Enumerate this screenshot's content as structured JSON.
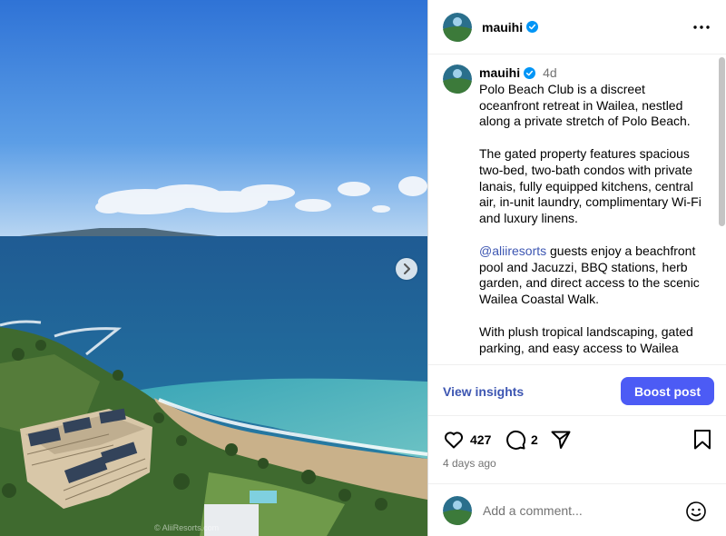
{
  "post": {
    "username": "mauihi",
    "timestamp": "4d",
    "caption": {
      "p1": "Polo Beach Club is a discreet oceanfront retreat in Wailea, nestled along a private stretch of Polo Beach.",
      "p2": "The gated property features spacious two-bed, two-bath condos with private lanais, fully equipped kitchens, central air, in-unit laundry, complimentary Wi-Fi and luxury linens.",
      "p3_mention": "@aliiresorts",
      "p3_rest": " guests enjoy a beachfront pool and Jacuzzi, BBQ stations, herb garden, and direct access to the scenic Wailea Coastal Walk.",
      "p4": "With plush tropical landscaping, gated parking, and easy access to Wailea"
    },
    "insights_label": "View insights",
    "boost_label": "Boost post",
    "likes": "427",
    "comments": "2",
    "date": "4 days ago",
    "comment_placeholder": "Add a comment...",
    "watermark": "© AliiResorts.com"
  },
  "icons": {
    "verified": "verified-badge-icon",
    "more": "more-options-icon",
    "next": "chevron-right-icon",
    "like": "heart-icon",
    "comment": "comment-bubble-icon",
    "share": "paper-plane-icon",
    "save": "bookmark-icon",
    "emoji": "smiley-icon"
  },
  "colors": {
    "link": "#3d56b2",
    "boost": "#4c5bf5",
    "verified": "#0095f6",
    "muted": "#737373"
  }
}
